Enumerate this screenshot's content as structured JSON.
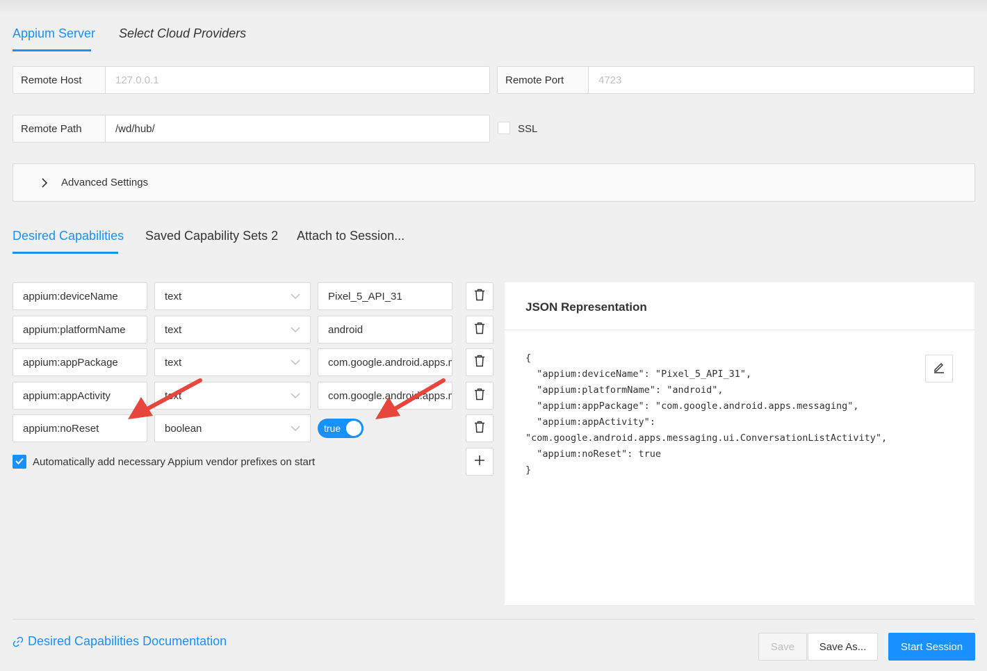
{
  "server_tabs": {
    "appium_server": "Appium Server",
    "cloud_providers": "Select Cloud Providers"
  },
  "server": {
    "remote_host_label": "Remote Host",
    "remote_host_placeholder": "127.0.0.1",
    "remote_port_label": "Remote Port",
    "remote_port_placeholder": "4723",
    "remote_path_label": "Remote Path",
    "remote_path_value": "/wd/hub/",
    "ssl_label": "SSL",
    "ssl_checked": false,
    "advanced_settings": "Advanced Settings"
  },
  "cap_tabs": {
    "desired": "Desired Capabilities",
    "saved_sets": "Saved Capability Sets 2",
    "attach": "Attach to Session..."
  },
  "capabilities": [
    {
      "name": "appium:deviceName",
      "type": "text",
      "value": "Pixel_5_API_31"
    },
    {
      "name": "appium:platformName",
      "type": "text",
      "value": "android"
    },
    {
      "name": "appium:appPackage",
      "type": "text",
      "value": "com.google.android.apps.messaging"
    },
    {
      "name": "appium:appActivity",
      "type": "text",
      "value": "com.google.android.apps.messaging.ui.ConversationListActivity"
    },
    {
      "name": "appium:noReset",
      "type": "boolean",
      "value": "true"
    }
  ],
  "auto_prefix": {
    "label": "Automatically add necessary Appium vendor prefixes on start",
    "checked": true
  },
  "json_panel": {
    "title": "JSON Representation",
    "lines": [
      "{",
      "  \"appium:deviceName\": \"Pixel_5_API_31\",",
      "  \"appium:platformName\": \"android\",",
      "  \"appium:appPackage\": \"com.google.android.apps.messaging\",",
      "  \"appium:appActivity\":",
      "\"com.google.android.apps.messaging.ui.ConversationListActivity\",",
      "  \"appium:noReset\": true",
      "}"
    ]
  },
  "footer": {
    "doc_link": "Desired Capabilities Documentation",
    "save": "Save",
    "save_as": "Save As...",
    "start_session": "Start Session"
  },
  "colors": {
    "accent": "#1890ff",
    "annotation_arrow": "#e8453c",
    "background": "#f0f0f0"
  }
}
